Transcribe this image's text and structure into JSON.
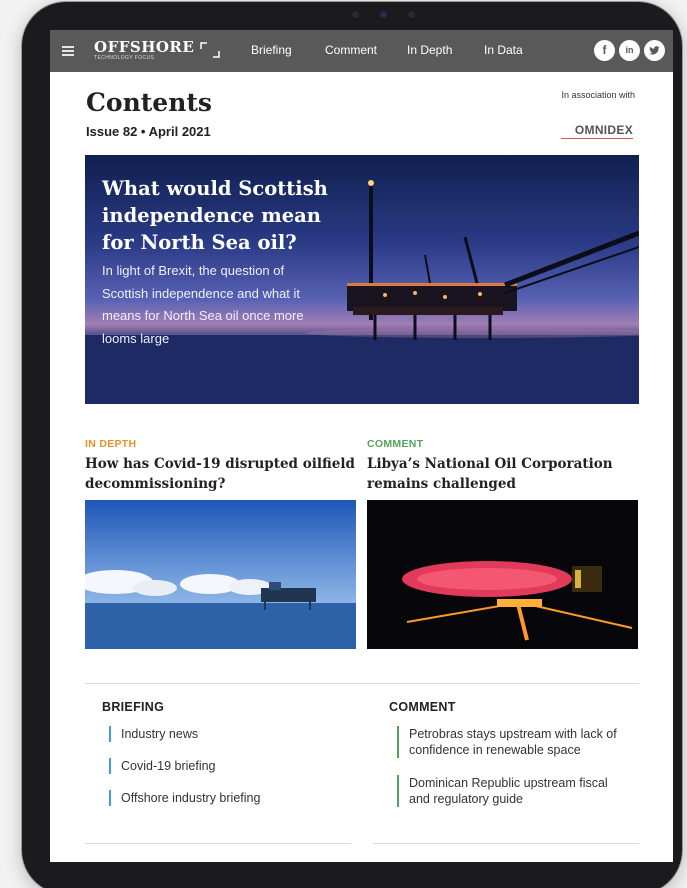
{
  "nav": {
    "logo": "OFFSHORE",
    "logo_sub": "TECHNOLOGY FOCUS",
    "links": [
      "Briefing",
      "Comment",
      "In Depth",
      "In Data"
    ],
    "social": [
      "f",
      "in",
      "t"
    ]
  },
  "header": {
    "title": "Contents",
    "issue": "Issue 82 • April 2021",
    "association": "In association with",
    "sponsor": "OMNIDEX"
  },
  "hero": {
    "title": "What would Scottish independence mean for North Sea oil?",
    "description": "In light of Brexit, the question of Scottish independence and what it means for North Sea oil once more looms large"
  },
  "articles": [
    {
      "tag": "IN DEPTH",
      "tag_color": "#e8912a",
      "title": "How has Covid-19 disrupted oilfield decommissioning?"
    },
    {
      "tag": "COMMENT",
      "tag_color": "#54a35a",
      "title": "Libya’s National Oil Corporation remains challenged"
    }
  ],
  "briefing": {
    "heading": "BRIEFING",
    "items": [
      "Industry news",
      "Covid-19 briefing",
      "Offshore industry briefing"
    ]
  },
  "comment": {
    "heading": "COMMENT",
    "items": [
      "Petrobras stays upstream with lack of confidence in renewable space",
      "Dominican Republic upstream fiscal and regulatory guide"
    ]
  },
  "colors": {
    "nav_bg": "#595959",
    "briefing_accent": "#3aa0d8",
    "comment_accent": "#54a35a"
  }
}
